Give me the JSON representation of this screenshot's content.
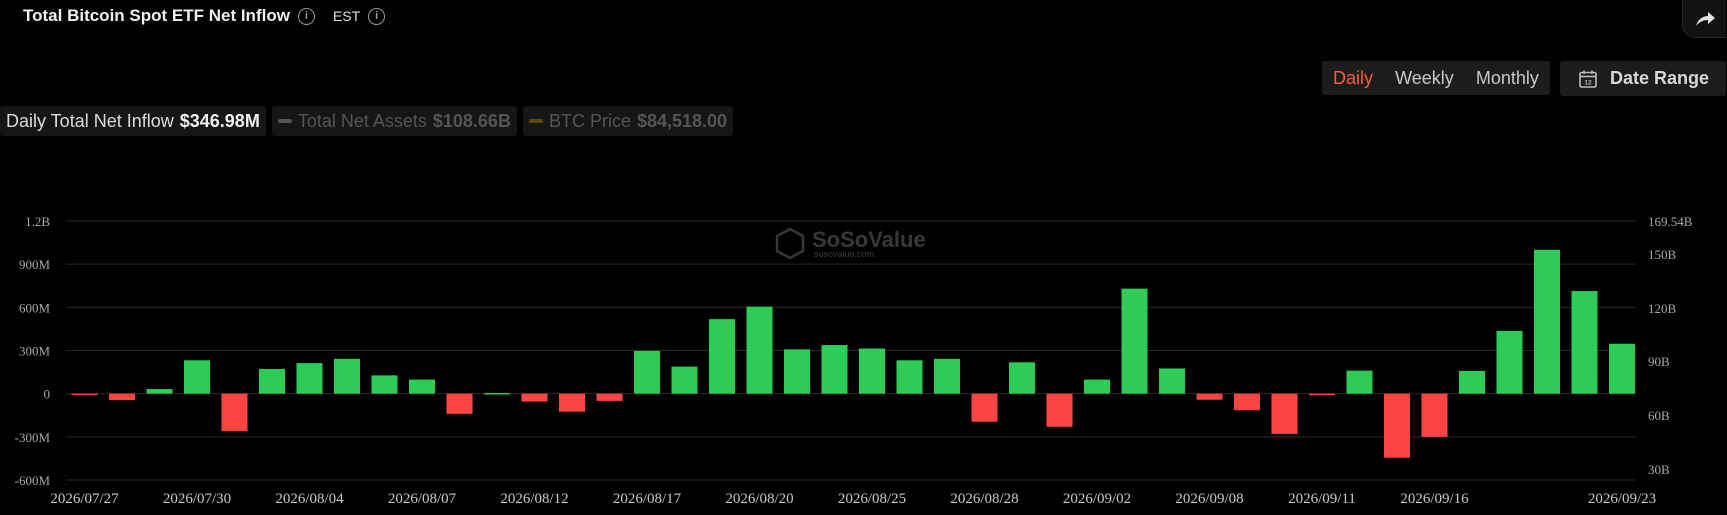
{
  "header": {
    "title": "Total Bitcoin Spot ETF Net Inflow",
    "timezone": "EST"
  },
  "controls": {
    "periods": [
      "Daily",
      "Weekly",
      "Monthly"
    ],
    "active_period": "Daily",
    "date_range_label": "Date Range",
    "date_range_icon": "calendar-icon",
    "share_icon": "share-arrow-icon"
  },
  "metrics": [
    {
      "label": "Daily Total Net Inflow",
      "value": "$346.98M",
      "active": true,
      "color": ""
    },
    {
      "label": "Total Net Assets",
      "value": "$108.66B",
      "active": false,
      "color": "#555555"
    },
    {
      "label": "BTC Price",
      "value": "$84,518.00",
      "active": false,
      "color": "#5a4a10"
    }
  ],
  "watermark": {
    "brand": "SoSoValue",
    "url": "sosovalue.com"
  },
  "colors": {
    "positive": "#2ecc57",
    "negative": "#ff4444",
    "accent": "#ff5a3c",
    "grid": "#2a2a2a",
    "axis_text": "#a8a8a8"
  },
  "chart_data": {
    "type": "bar",
    "title": "Total Bitcoin Spot ETF Net Inflow",
    "y_left": {
      "ticks": [
        "1.2B",
        "900M",
        "600M",
        "300M",
        "0",
        "-300M",
        "-600M"
      ],
      "tick_values": [
        1200,
        900,
        600,
        300,
        0,
        -300,
        -600
      ],
      "range": [
        -600,
        1200
      ],
      "unit": "M USD"
    },
    "y_right": {
      "ticks": [
        "169.54B",
        "150B",
        "120B",
        "90B",
        "60B",
        "30B"
      ]
    },
    "x_ticks": [
      {
        "label": "2026/07/27",
        "index": 0
      },
      {
        "label": "2026/07/30",
        "index": 3
      },
      {
        "label": "2026/08/04",
        "index": 6
      },
      {
        "label": "2026/08/07",
        "index": 9
      },
      {
        "label": "2026/08/12",
        "index": 12
      },
      {
        "label": "2026/08/17",
        "index": 15
      },
      {
        "label": "2026/08/20",
        "index": 18
      },
      {
        "label": "2026/08/25",
        "index": 21
      },
      {
        "label": "2026/08/28",
        "index": 24
      },
      {
        "label": "2026/09/02",
        "index": 27
      },
      {
        "label": "2026/09/08",
        "index": 30
      },
      {
        "label": "2026/09/11",
        "index": 33
      },
      {
        "label": "2026/09/16",
        "index": 36
      },
      {
        "label": "2026/09/23",
        "index": 41
      }
    ],
    "values": [
      -8,
      -45,
      32,
      232,
      -260,
      172,
      212,
      242,
      127,
      98,
      -140,
      5,
      -55,
      -125,
      -50,
      297,
      188,
      518,
      605,
      308,
      338,
      314,
      232,
      242,
      -195,
      218,
      -230,
      98,
      730,
      175,
      -42,
      -115,
      -280,
      -10,
      160,
      -445,
      -300,
      158,
      436,
      1000,
      713,
      347
    ],
    "grid": true,
    "legend": "none"
  }
}
